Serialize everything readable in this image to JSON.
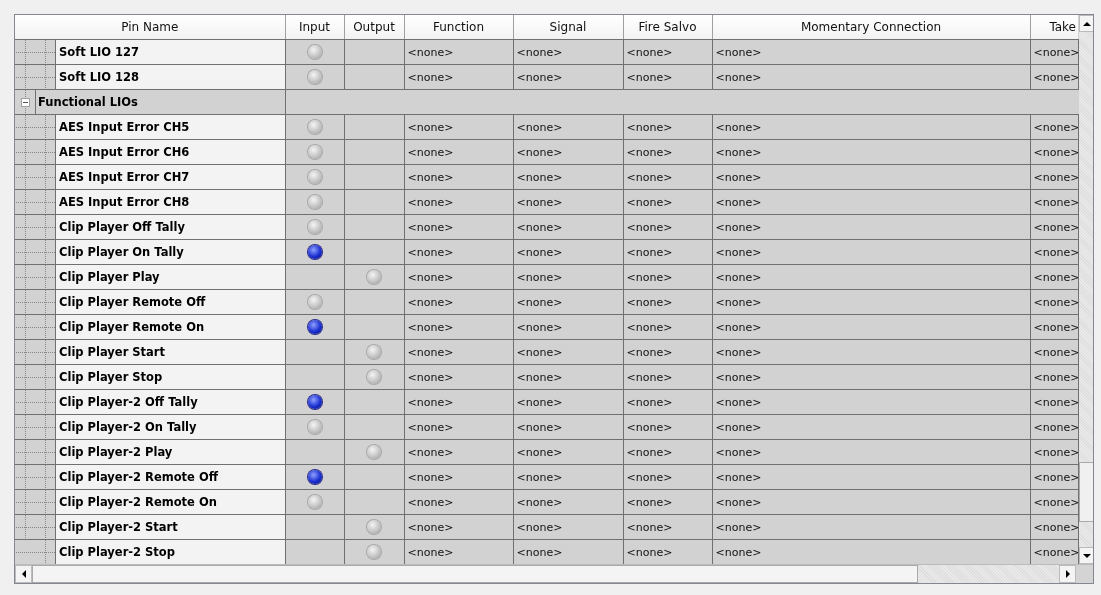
{
  "table": {
    "columns": [
      "Pin Name",
      "Input",
      "Output",
      "Function",
      "Signal",
      "Fire Salvo",
      "Momentary Connection",
      "Take"
    ],
    "rows": [
      {
        "kind": "item",
        "name": "Soft LIO 127",
        "input_lit": false,
        "function": "<none>",
        "signal": "<none>",
        "fire_salvo": "<none>",
        "momentary_connection": "<none>",
        "take": "<none>"
      },
      {
        "kind": "item",
        "name": "Soft LIO 128",
        "input_lit": false,
        "function": "<none>",
        "signal": "<none>",
        "fire_salvo": "<none>",
        "momentary_connection": "<none>",
        "take": "<none>"
      },
      {
        "kind": "group",
        "name": "Functional LIOs",
        "expanded": true,
        "children": [
          {
            "kind": "item",
            "name": "AES Input Error CH5",
            "input_lit": false,
            "function": "<none>",
            "signal": "<none>",
            "fire_salvo": "<none>",
            "momentary_connection": "<none>",
            "take": "<none>"
          },
          {
            "kind": "item",
            "name": "AES Input Error CH6",
            "input_lit": false,
            "function": "<none>",
            "signal": "<none>",
            "fire_salvo": "<none>",
            "momentary_connection": "<none>",
            "take": "<none>"
          },
          {
            "kind": "item",
            "name": "AES Input Error CH7",
            "input_lit": false,
            "function": "<none>",
            "signal": "<none>",
            "fire_salvo": "<none>",
            "momentary_connection": "<none>",
            "take": "<none>"
          },
          {
            "kind": "item",
            "name": "AES Input Error CH8",
            "input_lit": false,
            "function": "<none>",
            "signal": "<none>",
            "fire_salvo": "<none>",
            "momentary_connection": "<none>",
            "take": "<none>"
          },
          {
            "kind": "item",
            "name": "Clip Player Off Tally",
            "input_lit": false,
            "function": "<none>",
            "signal": "<none>",
            "fire_salvo": "<none>",
            "momentary_connection": "<none>",
            "take": "<none>"
          },
          {
            "kind": "item",
            "name": "Clip Player On Tally",
            "input_lit": true,
            "function": "<none>",
            "signal": "<none>",
            "fire_salvo": "<none>",
            "momentary_connection": "<none>",
            "take": "<none>"
          },
          {
            "kind": "item",
            "name": "Clip Player Play",
            "output_lit": false,
            "function": "<none>",
            "signal": "<none>",
            "fire_salvo": "<none>",
            "momentary_connection": "<none>",
            "take": "<none>"
          },
          {
            "kind": "item",
            "name": "Clip Player Remote Off",
            "input_lit": false,
            "function": "<none>",
            "signal": "<none>",
            "fire_salvo": "<none>",
            "momentary_connection": "<none>",
            "take": "<none>"
          },
          {
            "kind": "item",
            "name": "Clip Player Remote On",
            "input_lit": true,
            "function": "<none>",
            "signal": "<none>",
            "fire_salvo": "<none>",
            "momentary_connection": "<none>",
            "take": "<none>"
          },
          {
            "kind": "item",
            "name": "Clip Player Start",
            "output_lit": false,
            "function": "<none>",
            "signal": "<none>",
            "fire_salvo": "<none>",
            "momentary_connection": "<none>",
            "take": "<none>"
          },
          {
            "kind": "item",
            "name": "Clip Player Stop",
            "output_lit": false,
            "function": "<none>",
            "signal": "<none>",
            "fire_salvo": "<none>",
            "momentary_connection": "<none>",
            "take": "<none>"
          },
          {
            "kind": "item",
            "name": "Clip Player-2 Off Tally",
            "input_lit": true,
            "function": "<none>",
            "signal": "<none>",
            "fire_salvo": "<none>",
            "momentary_connection": "<none>",
            "take": "<none>"
          },
          {
            "kind": "item",
            "name": "Clip Player-2 On Tally",
            "input_lit": false,
            "function": "<none>",
            "signal": "<none>",
            "fire_salvo": "<none>",
            "momentary_connection": "<none>",
            "take": "<none>"
          },
          {
            "kind": "item",
            "name": "Clip Player-2 Play",
            "output_lit": false,
            "function": "<none>",
            "signal": "<none>",
            "fire_salvo": "<none>",
            "momentary_connection": "<none>",
            "take": "<none>"
          },
          {
            "kind": "item",
            "name": "Clip Player-2 Remote Off",
            "input_lit": true,
            "function": "<none>",
            "signal": "<none>",
            "fire_salvo": "<none>",
            "momentary_connection": "<none>",
            "take": "<none>"
          },
          {
            "kind": "item",
            "name": "Clip Player-2 Remote On",
            "input_lit": false,
            "function": "<none>",
            "signal": "<none>",
            "fire_salvo": "<none>",
            "momentary_connection": "<none>",
            "take": "<none>"
          },
          {
            "kind": "item",
            "name": "Clip Player-2 Start",
            "output_lit": false,
            "function": "<none>",
            "signal": "<none>",
            "fire_salvo": "<none>",
            "momentary_connection": "<none>",
            "take": "<none>"
          },
          {
            "kind": "item",
            "name": "Clip Player-2 Stop",
            "output_lit": false,
            "function": "<none>",
            "signal": "<none>",
            "fire_salvo": "<none>",
            "momentary_connection": "<none>",
            "take": "<none>"
          }
        ]
      }
    ]
  }
}
